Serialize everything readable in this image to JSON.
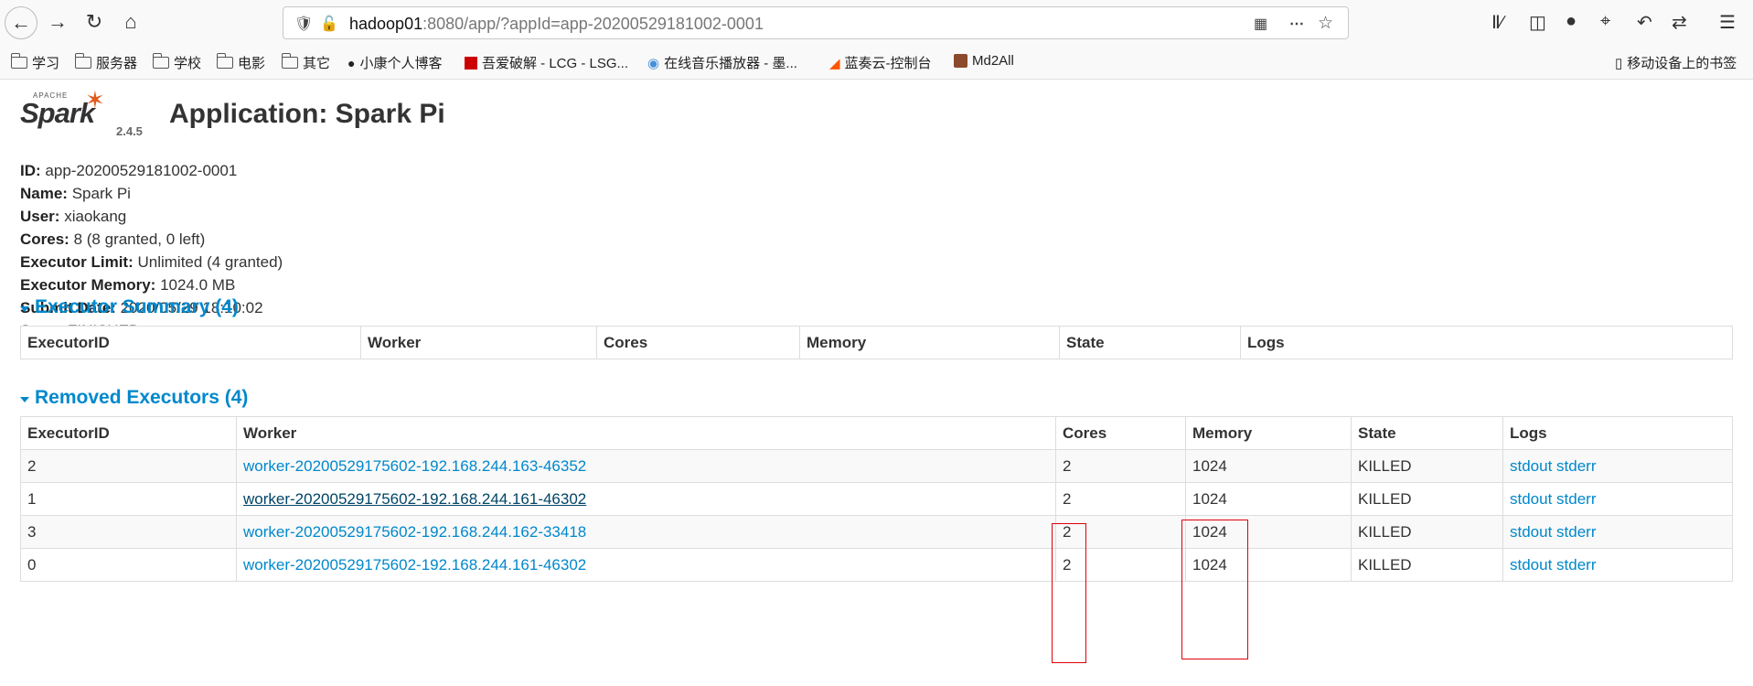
{
  "browser": {
    "url_host": "hadoop01",
    "url_rest": ":8080/app/?appId=app-20200529181002-0001",
    "bookmarks": [
      "学习",
      "服务器",
      "学校",
      "电影",
      "其它",
      "小康个人博客",
      "吾爱破解 - LCG - LSG...",
      "在线音乐播放器 - 墨...",
      "蓝奏云-控制台",
      "Md2All"
    ],
    "mobile_bookmarks": "移动设备上的书签"
  },
  "logo": {
    "apache": "APACHE",
    "spark": "Spark",
    "version": "2.4.5"
  },
  "page_title": "Application: Spark Pi",
  "info": [
    {
      "label": "ID:",
      "value": "app-20200529181002-0001"
    },
    {
      "label": "Name:",
      "value": "Spark Pi"
    },
    {
      "label": "User:",
      "value": "xiaokang"
    },
    {
      "label": "Cores:",
      "value": "8 (8 granted, 0 left)"
    },
    {
      "label": "Executor Limit:",
      "value": "Unlimited (4 granted)"
    },
    {
      "label": "Executor Memory:",
      "value": "1024.0 MB"
    },
    {
      "label": "Submit Date:",
      "value": "2020/05/29 18:10:02"
    },
    {
      "label": "State:",
      "value": "FINISHED"
    }
  ],
  "executor_summary": {
    "title": "Executor Summary (4)",
    "headers": [
      "ExecutorID",
      "Worker",
      "Cores",
      "Memory",
      "State",
      "Logs"
    ]
  },
  "removed_executors": {
    "title": "Removed Executors (4)",
    "headers": [
      "ExecutorID",
      "Worker",
      "Cores",
      "Memory",
      "State",
      "Logs"
    ],
    "rows": [
      {
        "id": "2",
        "worker": "worker-20200529175602-192.168.244.163-46352",
        "cores": "2",
        "memory": "1024",
        "state": "KILLED",
        "stdout": "stdout",
        "stderr": "stderr"
      },
      {
        "id": "1",
        "worker": "worker-20200529175602-192.168.244.161-46302",
        "cores": "2",
        "memory": "1024",
        "state": "KILLED",
        "stdout": "stdout",
        "stderr": "stderr"
      },
      {
        "id": "3",
        "worker": "worker-20200529175602-192.168.244.162-33418",
        "cores": "2",
        "memory": "1024",
        "state": "KILLED",
        "stdout": "stdout",
        "stderr": "stderr"
      },
      {
        "id": "0",
        "worker": "worker-20200529175602-192.168.244.161-46302",
        "cores": "2",
        "memory": "1024",
        "state": "KILLED",
        "stdout": "stdout",
        "stderr": "stderr"
      }
    ]
  },
  "colors": {
    "link": "#0088cc",
    "spark_orange": "#e25a1c",
    "highlight": "#e0000b"
  }
}
